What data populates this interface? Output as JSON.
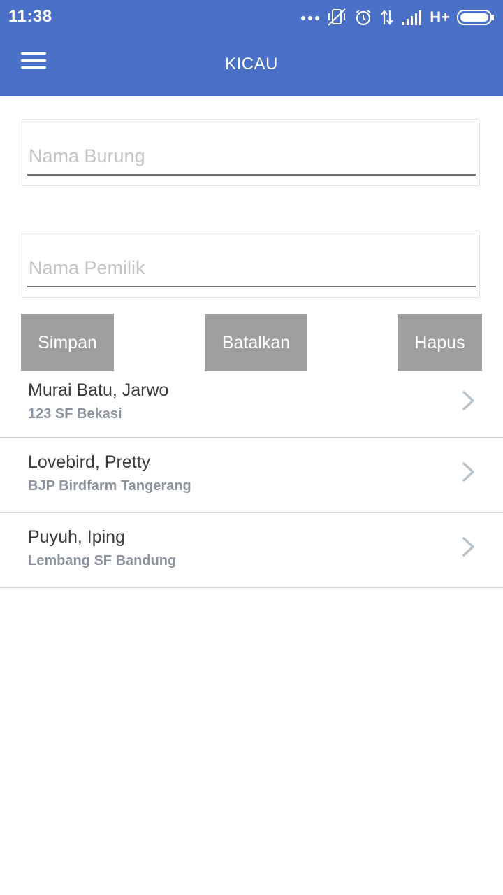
{
  "status_bar": {
    "time": "11:38",
    "network": "H+",
    "icons": [
      "more-dots-icon",
      "vibrate-off-icon",
      "alarm-icon",
      "data-transfer-icon",
      "signal-icon",
      "battery-icon"
    ]
  },
  "app_bar": {
    "title": "KICAU",
    "menu_icon": "hamburger-menu-icon",
    "color": "#4a6fc7"
  },
  "form": {
    "bird_name": {
      "value": "",
      "placeholder": "Nama Burung"
    },
    "owner_name": {
      "value": "",
      "placeholder": "Nama Pemilik"
    }
  },
  "buttons": {
    "save": "Simpan",
    "cancel": "Batalkan",
    "delete": "Hapus",
    "color": "#9e9e9e"
  },
  "list": {
    "items": [
      {
        "title": "Murai Batu, Jarwo",
        "subtitle": "123 SF Bekasi"
      },
      {
        "title": "Lovebird, Pretty",
        "subtitle": "BJP Birdfarm Tangerang"
      },
      {
        "title": "Puyuh, Iping",
        "subtitle": "Lembang SF Bandung"
      }
    ]
  }
}
